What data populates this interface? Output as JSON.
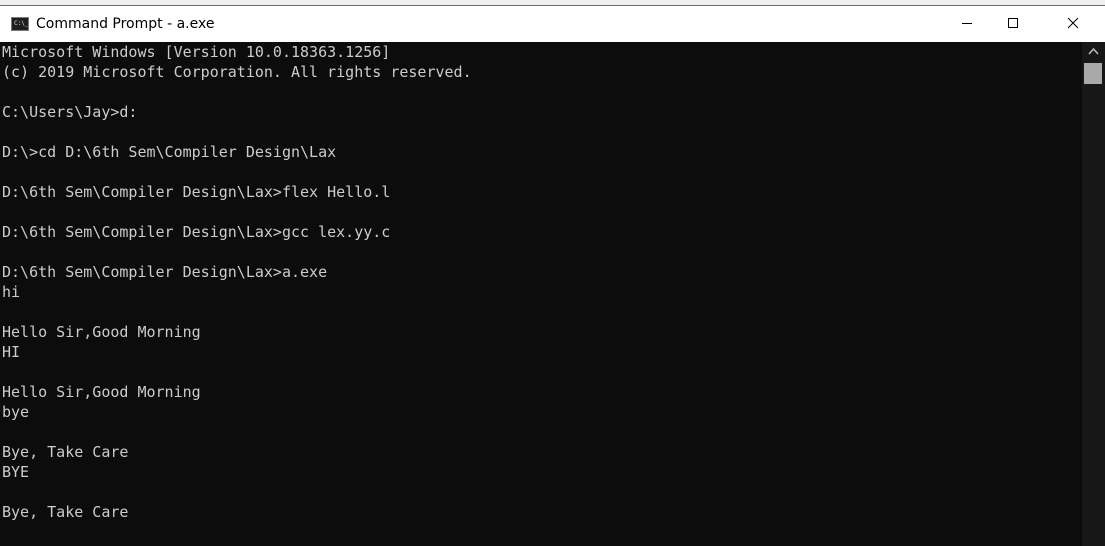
{
  "window": {
    "title": "Command Prompt - a.exe"
  },
  "app_icon": {
    "glyph": "C:\\_"
  },
  "controls": {
    "minimize_icon": "minimize-icon",
    "maximize_icon": "maximize-icon",
    "close_icon": "close-icon"
  },
  "console": {
    "lines": [
      "Microsoft Windows [Version 10.0.18363.1256]",
      "(c) 2019 Microsoft Corporation. All rights reserved.",
      "",
      "C:\\Users\\Jay>d:",
      "",
      "D:\\>cd D:\\6th Sem\\Compiler Design\\Lax",
      "",
      "D:\\6th Sem\\Compiler Design\\Lax>flex Hello.l",
      "",
      "D:\\6th Sem\\Compiler Design\\Lax>gcc lex.yy.c",
      "",
      "D:\\6th Sem\\Compiler Design\\Lax>a.exe",
      "hi",
      "",
      "Hello Sir,Good Morning",
      "HI",
      "",
      "Hello Sir,Good Morning",
      "bye",
      "",
      "Bye, Take Care",
      "BYE",
      "",
      "Bye, Take Care"
    ]
  },
  "colors": {
    "console_bg": "#0c0c0c",
    "console_text": "#cccccc",
    "titlebar_bg": "#ffffff",
    "scrollbar_thumb": "#a9a9a9"
  }
}
